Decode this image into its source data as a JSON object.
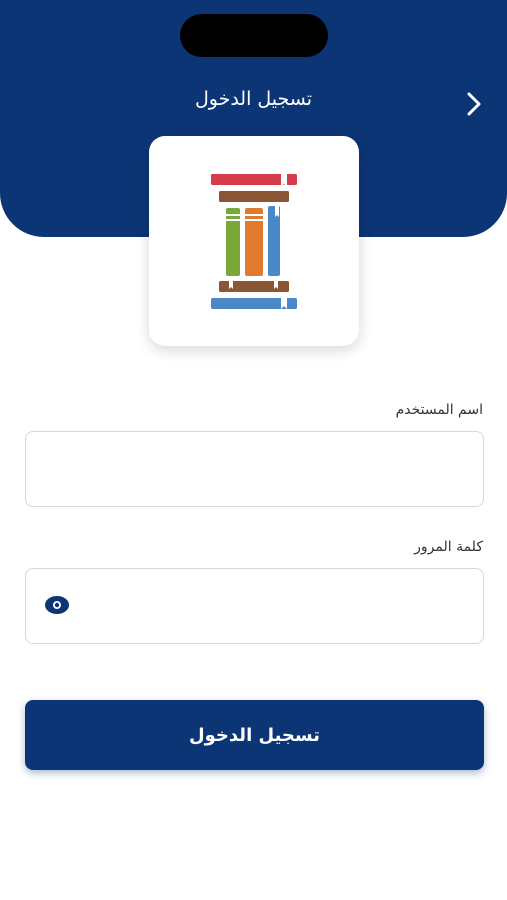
{
  "header": {
    "title": "تسجيل الدخول",
    "back_icon": "chevron-right-icon",
    "background_color": "#0c3576"
  },
  "logo": {
    "icon": "books-logo-icon",
    "colors": [
      "#d63c4b",
      "#8a5634",
      "#7aa73a",
      "#e07a2f",
      "#4a88c7"
    ]
  },
  "form": {
    "username": {
      "label": "اسم المستخدم",
      "value": "",
      "placeholder": ""
    },
    "password": {
      "label": "كلمة المرور",
      "value": "",
      "placeholder": "",
      "toggle_icon": "eye-icon"
    }
  },
  "login_button": {
    "label": "تسجيل الدخول",
    "color": "#0c3576"
  }
}
